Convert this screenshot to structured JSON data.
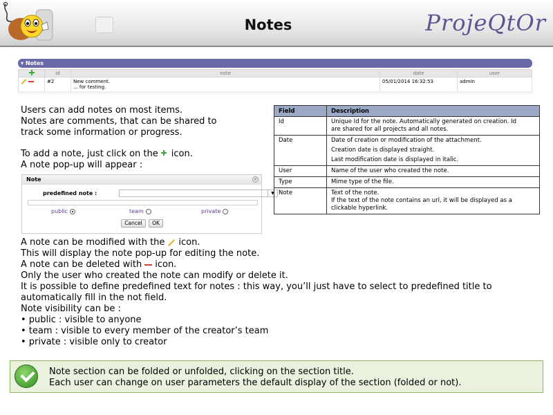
{
  "header": {
    "title": "Notes",
    "brand": "ProjeQtOr",
    "logo_icon": "smiley-mascot-logo"
  },
  "notes_section": {
    "title": "Notes",
    "columns": [
      "",
      "id",
      "note",
      "date",
      "user"
    ],
    "rows": [
      {
        "id": "#2",
        "note_line1": "New comment.",
        "note_line2": "... for testing.",
        "date": "05/01/2014 16:32:53",
        "user": "admin"
      }
    ]
  },
  "intro": {
    "line1": "Users can add notes on most items.",
    "line2": "Notes are comments, that can be shared to",
    "line3": "track some information or progress.",
    "add_pre": "To add a note, just click on the",
    "add_post": "icon.",
    "popup_line": "A note pop-up will appear :"
  },
  "popup": {
    "title": "Note",
    "predefined_label": "predefined note :",
    "visibility": [
      {
        "label": "public",
        "selected": true
      },
      {
        "label": "team",
        "selected": false
      },
      {
        "label": "private",
        "selected": false
      }
    ],
    "cancel": "Cancel",
    "ok": "OK"
  },
  "body": {
    "modify_pre": "A note can be modified with the",
    "modify_post": "icon.",
    "display_line": "This will display the note pop-up for editing the note.",
    "delete_pre": "A note can be deleted with",
    "delete_post": "icon.",
    "only_user": "Only the user who created the note can modify or delete it.",
    "predefined_1": "It is possible to define predefined text for notes : this way, you’ll just have to select to predefined title to",
    "predefined_2": "automatically fill in the not field.",
    "visibility_title": "Note visibility can be :",
    "visibility_items": [
      "• public : visible to anyone",
      "• team  : visible to every member of the creator’s team",
      "• private : visible only to creator"
    ]
  },
  "desc_table": {
    "headers": [
      "Field",
      "Description"
    ],
    "rows": [
      {
        "field": "Id",
        "lines": [
          "Unique Id for the note. Automatically generated on creation. Id",
          "are shared for all projects and all notes."
        ]
      },
      {
        "field": "Date",
        "lines": [
          "Date of creation or modification of the attachment.",
          "Creation date is displayed straight.",
          "Last modification date is displayed in italic."
        ]
      },
      {
        "field": "User",
        "lines": [
          "Name of the user who created the note."
        ]
      },
      {
        "field": "Type",
        "lines": [
          "Mime type of the file."
        ]
      },
      {
        "field": "Note",
        "lines": [
          "Text of the note.",
          "If the text of the note contains an url, it will be displayed as a",
          "clickable hyperlink."
        ]
      }
    ]
  },
  "callout": {
    "line1": "Note section can be folded or unfolded, clicking on the section title.",
    "line2": "Each user can change on user parameters the default display of the section (folded or not).",
    "icon": "check-icon"
  },
  "colors": {
    "section_bar": "#6b69a8",
    "table_header": "#9ca9c6",
    "callout_bg": "#eaf2de",
    "brand": "#5a5590"
  }
}
